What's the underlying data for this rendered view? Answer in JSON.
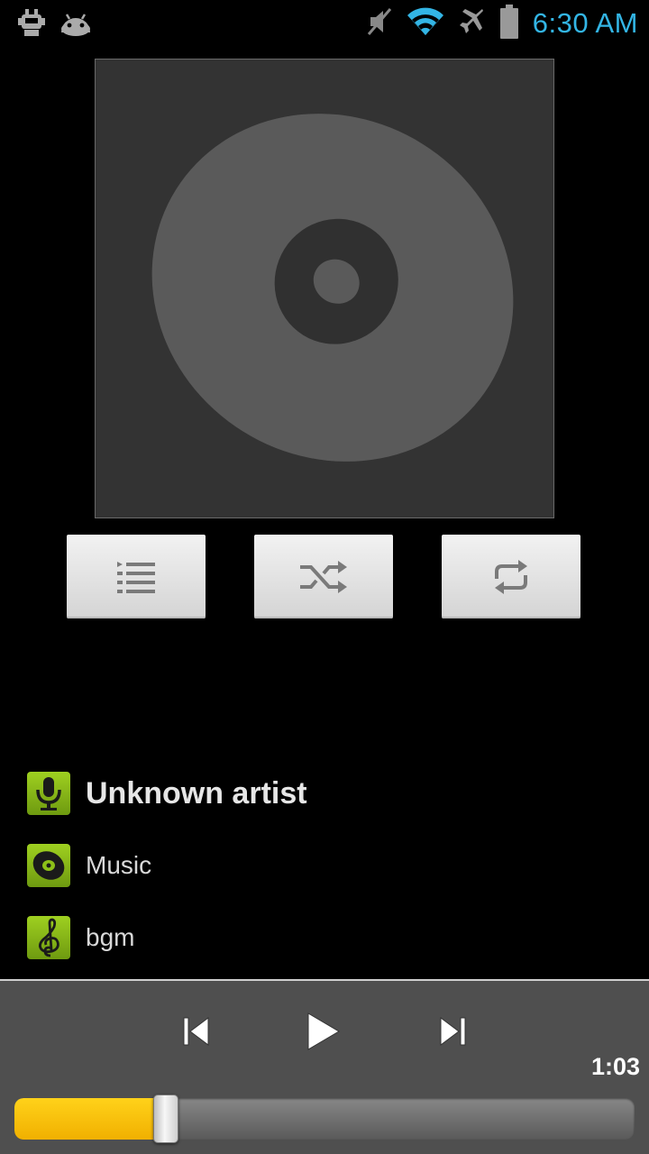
{
  "status_bar": {
    "time": "6:30 AM",
    "icons": [
      "usb-debug-icon",
      "android-icon",
      "mute-icon",
      "wifi-icon",
      "airplane-icon",
      "battery-icon"
    ],
    "time_color": "#33b5e5"
  },
  "album_art": {
    "icon": "disc-icon"
  },
  "controls": {
    "playlist_icon": "playlist-icon",
    "shuffle_icon": "shuffle-icon",
    "repeat_icon": "repeat-icon"
  },
  "track_info": {
    "artist": "Unknown artist",
    "album": "Music",
    "title": "bgm"
  },
  "playback": {
    "elapsed": "1:03",
    "progress_fraction": 0.244,
    "state": "paused",
    "accent_color": "#ffc40c"
  }
}
